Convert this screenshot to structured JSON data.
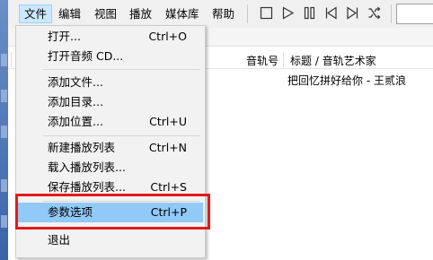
{
  "menubar": {
    "items": [
      "文件",
      "编辑",
      "视图",
      "播放",
      "媒体库",
      "帮助"
    ]
  },
  "toolbar": {
    "icons": [
      "stop-icon",
      "play-icon",
      "pause-icon",
      "previous-icon",
      "next-icon",
      "random-icon"
    ]
  },
  "playlist": {
    "columns": [
      "音轨号",
      "标题 / 音轨艺术家"
    ],
    "rows": [
      {
        "title": "把回忆拼好给你 - 王贰浪"
      }
    ]
  },
  "file_menu": {
    "items": [
      {
        "label": "打开...",
        "shortcut": "Ctrl+O"
      },
      {
        "label": "打开音频 CD...",
        "shortcut": ""
      },
      {
        "label": "添加文件...",
        "shortcut": ""
      },
      {
        "label": "添加目录...",
        "shortcut": ""
      },
      {
        "label": "添加位置...",
        "shortcut": "Ctrl+U"
      },
      {
        "label": "新建播放列表",
        "shortcut": "Ctrl+N"
      },
      {
        "label": "载入播放列表...",
        "shortcut": ""
      },
      {
        "label": "保存播放列表...",
        "shortcut": "Ctrl+S"
      },
      {
        "label": "参数选项",
        "shortcut": "Ctrl+P"
      },
      {
        "label": "退出",
        "shortcut": ""
      }
    ]
  },
  "colors": {
    "highlight": "#91c9f7",
    "annotation_box": "#e31b1b",
    "active_menu": "#cce8ff"
  }
}
